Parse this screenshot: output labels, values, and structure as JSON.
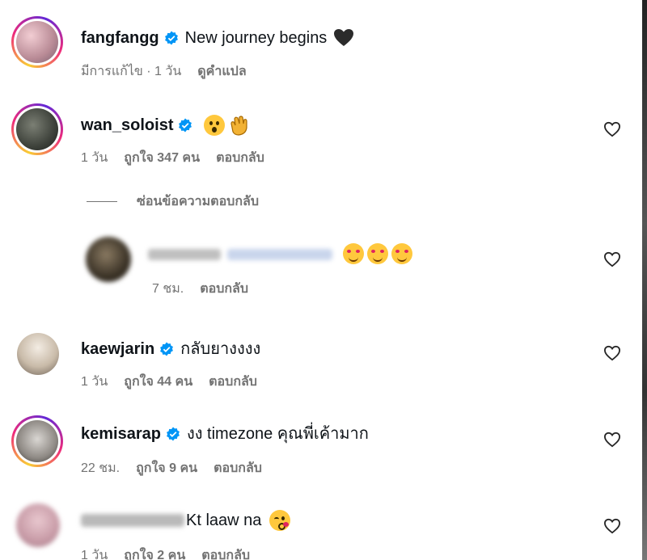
{
  "caption": {
    "username": "fangfangg",
    "text": "New journey begins",
    "emoji": "black-heart",
    "meta": {
      "edited": "มีการแก้ไข · 1 วัน",
      "translate": "ดูคำแปล"
    }
  },
  "comments": [
    {
      "username": "wan_soloist",
      "text": "",
      "emojis": [
        "astonished-face",
        "clapping-hands"
      ],
      "time": "1 วัน",
      "likes": "ถูกใจ 347 คน",
      "reply": "ตอบกลับ"
    },
    {
      "username": "kaewjarin",
      "text": "กลับยางงงง",
      "time": "1 วัน",
      "likes": "ถูกใจ 44 คน",
      "reply": "ตอบกลับ"
    },
    {
      "username": "kemisarap",
      "text": "งง timezone คุณพี่เค้ามาก",
      "time": "22 ชม.",
      "likes": "ถูกใจ 9 คน",
      "reply": "ตอบกลับ"
    },
    {
      "username": "",
      "text": "Kt laaw na",
      "emojis": [
        "face-blowing-kiss"
      ],
      "time": "1 วัน",
      "likes": "ถูกใจ 2 คน",
      "reply": "ตอบกลับ"
    }
  ],
  "replies_toggle": "ซ่อนข้อความตอบกลับ",
  "reply": {
    "emojis": [
      "smiling-face-with-hearts",
      "smiling-face-with-hearts",
      "smiling-face-with-hearts"
    ],
    "time": "7 ชม.",
    "reply": "ตอบกลับ"
  },
  "colors": {
    "verified": "#0095f6",
    "meta": "#737373"
  }
}
